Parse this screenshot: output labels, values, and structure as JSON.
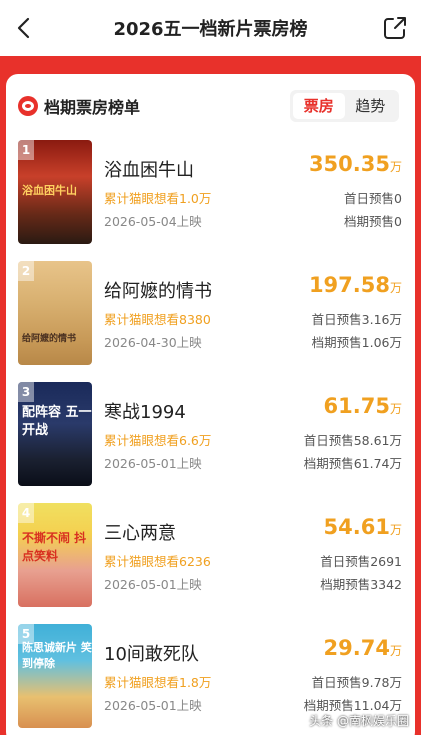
{
  "header": {
    "title": "2026五一档新片票房榜",
    "back_icon": "chevron-left-icon",
    "share_icon": "share-icon"
  },
  "section": {
    "title": "档期票房榜单",
    "icon": "maoyan-cat-icon",
    "tabs": [
      {
        "label": "票房",
        "active": true
      },
      {
        "label": "趋势",
        "active": false
      }
    ]
  },
  "colors": {
    "brand_red": "#e8312b",
    "gross_orange": "#f0a020"
  },
  "movies": [
    {
      "rank": "1",
      "name": "浴血困牛山",
      "gross": "350.35",
      "unit": "万",
      "want": "累计猫眼想看1.0万",
      "release": "2026-05-04上映",
      "presale_first": "首日预售0",
      "presale_period": "档期预售0",
      "poster_text": "浴血困牛山"
    },
    {
      "rank": "2",
      "name": "给阿嬷的情书",
      "gross": "197.58",
      "unit": "万",
      "want": "累计猫眼想看8380",
      "release": "2026-04-30上映",
      "presale_first": "首日预售3.16万",
      "presale_period": "档期预售1.06万",
      "poster_text": "给阿嬷的情书"
    },
    {
      "rank": "3",
      "name": "寒战1994",
      "gross": "61.75",
      "unit": "万",
      "want": "累计猫眼想看6.6万",
      "release": "2026-05-01上映",
      "presale_first": "首日预售58.61万",
      "presale_period": "档期预售61.74万",
      "poster_text": "配阵容 五一开战"
    },
    {
      "rank": "4",
      "name": "三心两意",
      "gross": "54.61",
      "unit": "万",
      "want": "累计猫眼想看6236",
      "release": "2026-05-01上映",
      "presale_first": "首日预售2691",
      "presale_period": "档期预售3342",
      "poster_text": "不撕不闹 抖点笑料"
    },
    {
      "rank": "5",
      "name": "10间敢死队",
      "gross": "29.74",
      "unit": "万",
      "want": "累计猫眼想看1.8万",
      "release": "2026-05-01上映",
      "presale_first": "首日预售9.78万",
      "presale_period": "档期预售11.04万",
      "poster_text": "陈思诚新片 笑到停除"
    }
  ],
  "watermark": "头条 @南枫娱乐圈"
}
